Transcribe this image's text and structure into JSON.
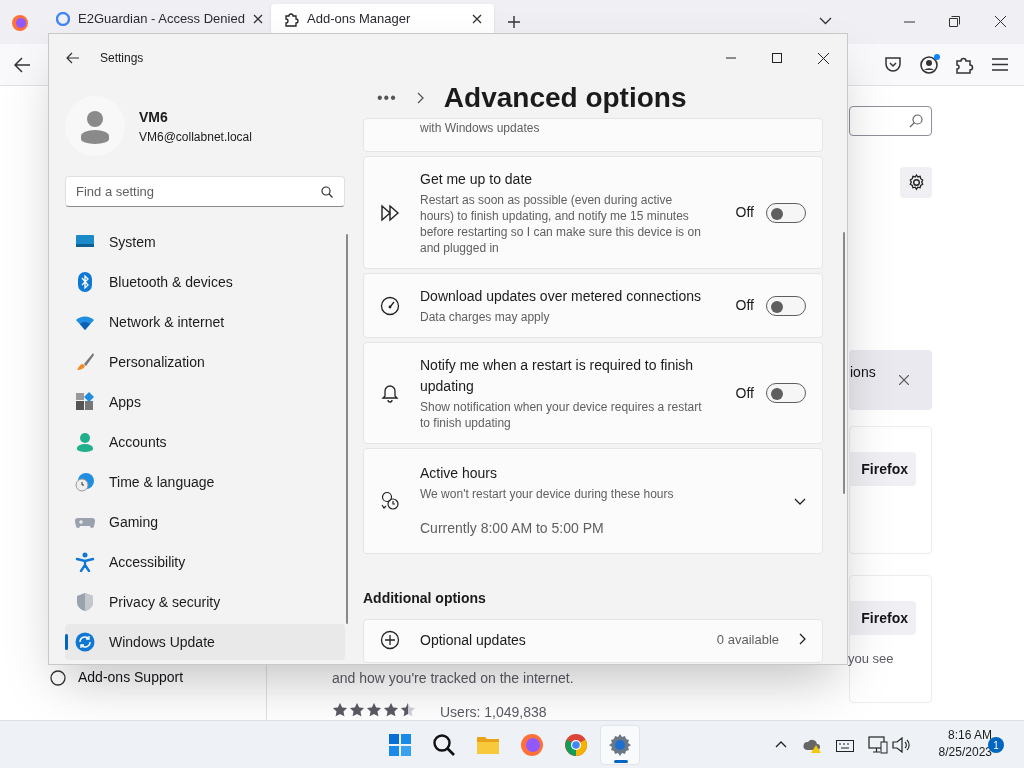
{
  "browser": {
    "tabs": [
      {
        "label": "E2Guardian - Access Denied",
        "selected": false
      },
      {
        "label": "Add-ons Manager",
        "selected": true
      }
    ],
    "page": {
      "notice_text": "ions",
      "buttons": [
        "Firefox",
        "Firefox"
      ],
      "support_link": "Add-ons Support",
      "description_end": "you see",
      "description_line": "and how you're tracked on the internet.",
      "stars": 4.5,
      "users": "Users: 1,049,838"
    }
  },
  "settings": {
    "title": "Settings",
    "user": {
      "name": "VM6",
      "email": "VM6@collabnet.local"
    },
    "search": {
      "placeholder": "Find a setting"
    },
    "nav": [
      {
        "label": "System",
        "selected": false
      },
      {
        "label": "Bluetooth & devices",
        "selected": false
      },
      {
        "label": "Network & internet",
        "selected": false
      },
      {
        "label": "Personalization",
        "selected": false
      },
      {
        "label": "Apps",
        "selected": false
      },
      {
        "label": "Accounts",
        "selected": false
      },
      {
        "label": "Time & language",
        "selected": false
      },
      {
        "label": "Gaming",
        "selected": false
      },
      {
        "label": "Accessibility",
        "selected": false
      },
      {
        "label": "Privacy & security",
        "selected": false
      },
      {
        "label": "Windows Update",
        "selected": true
      }
    ],
    "breadcrumb": "•••",
    "page_title": "Advanced options",
    "cards": [
      {
        "kind": "partial",
        "description": "with Windows updates"
      },
      {
        "kind": "toggle",
        "title": "Get me up to date",
        "description": "Restart as soon as possible (even during active hours) to finish updating, and notify me 15 minutes before restarting so I can make sure this device is on and plugged in",
        "state_text": "Off",
        "on": false
      },
      {
        "kind": "toggle",
        "title": "Download updates over metered connections",
        "description": "Data charges may apply",
        "state_text": "Off",
        "on": false
      },
      {
        "kind": "toggle",
        "title": "Notify me when a restart is required to finish updating",
        "description": "Show notification when your device requires a restart to finish updating",
        "state_text": "Off",
        "on": false
      },
      {
        "kind": "expander",
        "title": "Active hours",
        "description": "We won't restart your device during these hours",
        "value": "Currently 8:00 AM to 5:00 PM",
        "expanded": false
      }
    ],
    "section": "Additional options",
    "links": [
      {
        "title": "Optional updates",
        "value": "0 available"
      }
    ]
  },
  "taskbar": {
    "apps": [
      {
        "selected": false
      },
      {
        "selected": false
      },
      {
        "selected": false
      },
      {
        "selected": false
      },
      {
        "selected": false
      },
      {
        "selected": true
      }
    ],
    "time": "8:16 AM",
    "date": "8/25/2023",
    "badge": "1"
  }
}
